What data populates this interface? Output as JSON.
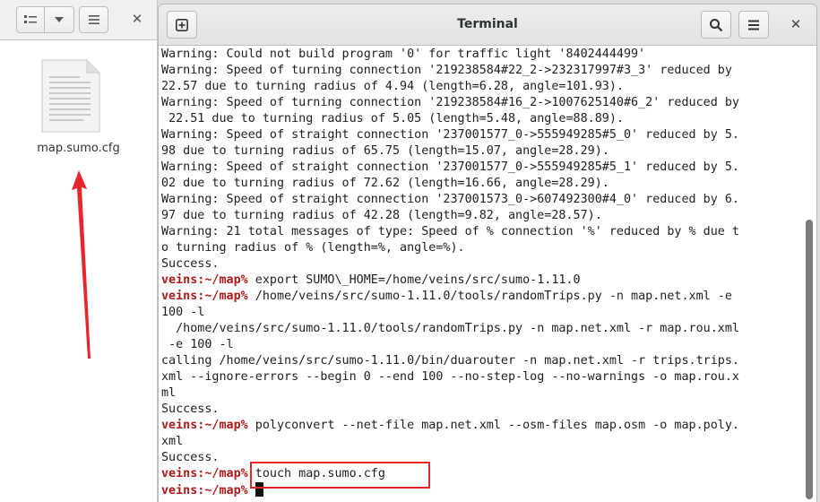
{
  "file_manager": {
    "file_name": "map.sumo.cfg"
  },
  "terminal": {
    "title": "Terminal",
    "prompt": "veins:~/map%",
    "lines": [
      {
        "type": "out",
        "text": "Warning: Could not build program '0' for traffic light '8402444499'"
      },
      {
        "type": "out",
        "text": "Warning: Speed of turning connection '219238584#22_2->232317997#3_3' reduced by"
      },
      {
        "type": "out",
        "text": "22.57 due to turning radius of 4.94 (length=6.28, angle=101.93)."
      },
      {
        "type": "out",
        "text": "Warning: Speed of turning connection '219238584#16_2->1007625140#6_2' reduced by"
      },
      {
        "type": "out",
        "text": " 22.51 due to turning radius of 5.05 (length=5.48, angle=88.89)."
      },
      {
        "type": "out",
        "text": "Warning: Speed of straight connection '237001577_0->555949285#5_0' reduced by 5."
      },
      {
        "type": "out",
        "text": "98 due to turning radius of 65.75 (length=15.07, angle=28.29)."
      },
      {
        "type": "out",
        "text": "Warning: Speed of straight connection '237001577_0->555949285#5_1' reduced by 5."
      },
      {
        "type": "out",
        "text": "02 due to turning radius of 72.62 (length=16.66, angle=28.29)."
      },
      {
        "type": "out",
        "text": "Warning: Speed of straight connection '237001573_0->607492300#4_0' reduced by 6."
      },
      {
        "type": "out",
        "text": "97 due to turning radius of 42.28 (length=9.82, angle=28.57)."
      },
      {
        "type": "out",
        "text": "Warning: 21 total messages of type: Speed of % connection '%' reduced by % due t"
      },
      {
        "type": "out",
        "text": "o turning radius of % (length=%, angle=%)."
      },
      {
        "type": "out",
        "text": "Success."
      },
      {
        "type": "cmd",
        "text": " export SUMO\\_HOME=/home/veins/src/sumo-1.11.0"
      },
      {
        "type": "cmd",
        "text": " /home/veins/src/sumo-1.11.0/tools/randomTrips.py -n map.net.xml -e"
      },
      {
        "type": "out",
        "text": "100 -l"
      },
      {
        "type": "out",
        "text": "  /home/veins/src/sumo-1.11.0/tools/randomTrips.py -n map.net.xml -r map.rou.xml"
      },
      {
        "type": "out",
        "text": " -e 100 -l"
      },
      {
        "type": "out",
        "text": "calling /home/veins/src/sumo-1.11.0/bin/duarouter -n map.net.xml -r trips.trips."
      },
      {
        "type": "out",
        "text": "xml --ignore-errors --begin 0 --end 100 --no-step-log --no-warnings -o map.rou.x"
      },
      {
        "type": "out",
        "text": "ml"
      },
      {
        "type": "out",
        "text": "Success."
      },
      {
        "type": "cmd",
        "text": " polyconvert --net-file map.net.xml --osm-files map.osm -o map.poly."
      },
      {
        "type": "out",
        "text": "xml"
      },
      {
        "type": "out",
        "text": "Success."
      },
      {
        "type": "cmd",
        "text": " touch map.sumo.cfg"
      },
      {
        "type": "cmd",
        "text": " ",
        "cursor": true
      }
    ]
  },
  "colors": {
    "prompt": "#b21818",
    "annotation": "#e8252b"
  }
}
